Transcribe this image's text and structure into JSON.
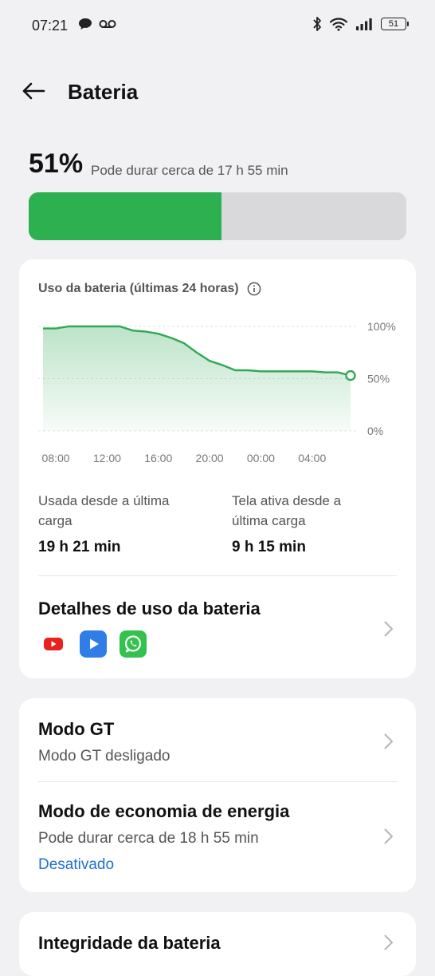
{
  "status_bar": {
    "time": "07:21",
    "battery_level": "51",
    "icons": [
      "chat-bubble-icon",
      "voicemail-icon",
      "bluetooth-icon",
      "wifi-icon",
      "signal-icon",
      "battery-icon"
    ]
  },
  "header": {
    "title": "Bateria"
  },
  "battery": {
    "percent": "51%",
    "level_fraction": 0.51,
    "estimate": "Pode durar cerca de 17 h 55 min",
    "fill_color": "#2db04f"
  },
  "usage_card": {
    "title": "Uso da bateria (últimas 24 horas)",
    "used_label": "Usada desde a última carga",
    "used_value": "19 h 21 min",
    "screen_label": "Tela ativa desde a última carga",
    "screen_value": "9 h 15 min",
    "details_title": "Detalhes de uso da bateria",
    "apps": [
      "youtube-icon",
      "play-video-icon",
      "whatsapp-icon"
    ]
  },
  "chart_data": {
    "type": "area",
    "x": [
      "07:00",
      "08:00",
      "09:00",
      "10:00",
      "11:00",
      "12:00",
      "13:00",
      "14:00",
      "15:00",
      "16:00",
      "17:00",
      "18:00",
      "19:00",
      "20:00",
      "21:00",
      "22:00",
      "23:00",
      "00:00",
      "01:00",
      "02:00",
      "03:00",
      "04:00",
      "05:00",
      "06:00",
      "07:00"
    ],
    "values": [
      98,
      98,
      100,
      100,
      100,
      100,
      100,
      96,
      95,
      93,
      89,
      84,
      75,
      67,
      63,
      58,
      58,
      57,
      57,
      57,
      57,
      57,
      56,
      56,
      53
    ],
    "xticks": [
      "08:00",
      "12:00",
      "16:00",
      "20:00",
      "00:00",
      "04:00"
    ],
    "yticks": [
      "100%",
      "50%",
      "0%"
    ],
    "ylim": [
      0,
      100
    ],
    "line_color": "#2fa853",
    "grid": true
  },
  "gt_card": {
    "gt_title": "Modo GT",
    "gt_status": "Modo GT desligado",
    "eco_title": "Modo de economia de energia",
    "eco_desc": "Pode durar cerca de 18 h 55 min",
    "eco_status": "Desativado"
  },
  "health_card": {
    "title": "Integridade da bateria"
  }
}
